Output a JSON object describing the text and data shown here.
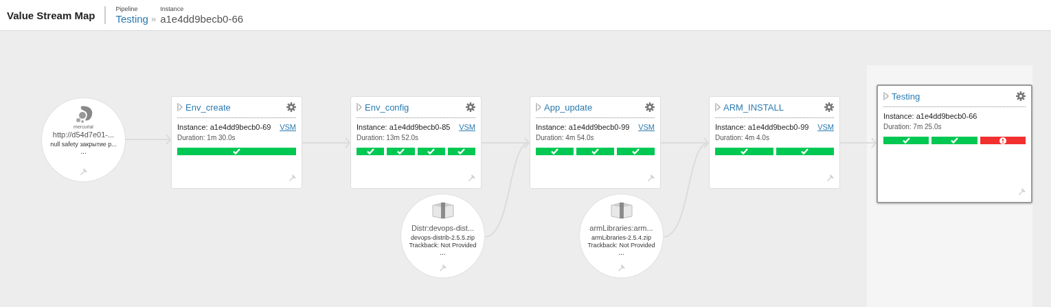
{
  "header": {
    "title": "Value Stream Map",
    "pipeline_label": "Pipeline",
    "pipeline": "Testing",
    "separator": "»",
    "instance_label": "Instance",
    "instance": "a1e4dd9becb0-66"
  },
  "materials": [
    {
      "kind": "scm",
      "logo_caption": "mercurial",
      "title": "http://d54d7e01-...",
      "lines": [
        "null safety закрытие p..."
      ],
      "more": "..."
    },
    {
      "kind": "package",
      "title": "Distr:devops-dist...",
      "lines": [
        "devops-distrib-2.5.5.zip",
        "Trackback: Not Provided"
      ],
      "more": "..."
    },
    {
      "kind": "package",
      "title": "armLibraries:arm...",
      "lines": [
        "armLibraries-2.5.4.zip",
        "Trackback: Not Provided"
      ],
      "more": "..."
    }
  ],
  "pipelines": [
    {
      "name": "Env_create",
      "instance": "Instance: a1e4dd9becb0-69",
      "vsm": "VSM",
      "duration": "Duration: 1m 30.0s",
      "current": false,
      "stages": [
        {
          "kind": "passed"
        }
      ]
    },
    {
      "name": "Env_config",
      "instance": "Instance: a1e4dd9becb0-85",
      "vsm": "VSM",
      "duration": "Duration: 13m 52.0s",
      "current": false,
      "stages": [
        {
          "kind": "passed"
        },
        {
          "kind": "passed"
        },
        {
          "kind": "passed"
        },
        {
          "kind": "passed"
        }
      ]
    },
    {
      "name": "App_update",
      "instance": "Instance: a1e4dd9becb0-99",
      "vsm": "VSM",
      "duration": "Duration: 4m 54.0s",
      "current": false,
      "stages": [
        {
          "kind": "passed"
        },
        {
          "kind": "passed"
        },
        {
          "kind": "passed"
        }
      ]
    },
    {
      "name": "ARM_INSTALL",
      "instance": "Instance: a1e4dd9becb0-99",
      "vsm": "VSM",
      "duration": "Duration: 4m 4.0s",
      "current": false,
      "stages": [
        {
          "kind": "passed"
        },
        {
          "kind": "passed"
        }
      ]
    },
    {
      "name": "Testing",
      "instance": "Instance: a1e4dd9becb0-66",
      "duration": "Duration: 7m 25.0s",
      "current": true,
      "stages": [
        {
          "kind": "passed"
        },
        {
          "kind": "passed"
        },
        {
          "kind": "failed"
        }
      ]
    }
  ]
}
